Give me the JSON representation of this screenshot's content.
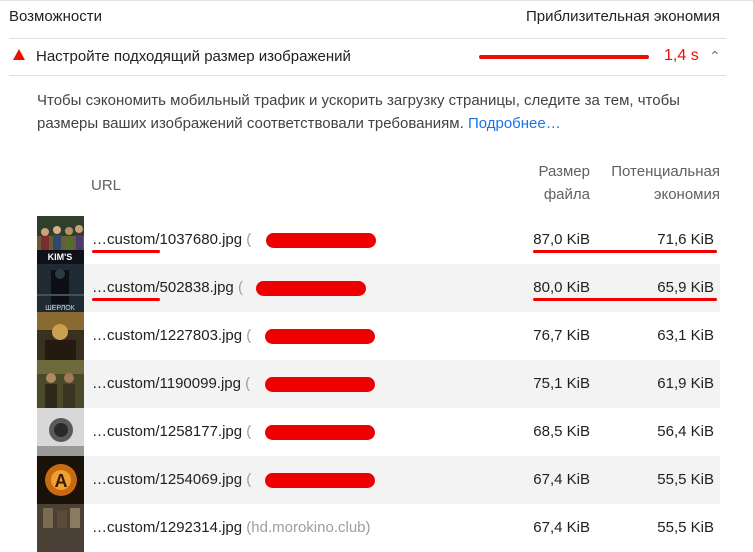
{
  "section": {
    "title": "Возможности",
    "column": "Приблизительная экономия"
  },
  "audit": {
    "title": "Настройте подходящий размер изображений",
    "savings": "1,4 s",
    "description": "Чтобы сэкономить мобильный трафик и ускорить загрузку страницы, следите за тем, чтобы размеры ваших изображений соответствовали требованиям.",
    "learn_more": "Подробнее…"
  },
  "table": {
    "headers": {
      "url": "URL",
      "size_1": "Размер",
      "size_2": "файла",
      "savings_1": "Потенциальная",
      "savings_2": "экономия"
    },
    "rows": [
      {
        "url": "…custom/1037680.jpg",
        "paren": "(",
        "size": "87,0 KiB",
        "savings": "71,6 KiB"
      },
      {
        "url": "…custom/502838.jpg",
        "paren": "(",
        "size": "80,0 KiB",
        "savings": "65,9 KiB"
      },
      {
        "url": "…custom/1227803.jpg",
        "paren": "(",
        "size": "76,7 KiB",
        "savings": "63,1 KiB"
      },
      {
        "url": "…custom/1190099.jpg",
        "paren": "(",
        "size": "75,1 KiB",
        "savings": "61,9 KiB"
      },
      {
        "url": "…custom/1258177.jpg",
        "paren": "(",
        "size": "68,5 KiB",
        "savings": "56,4 KiB"
      },
      {
        "url": "…custom/1254069.jpg",
        "paren": "(",
        "size": "67,4 KiB",
        "savings": "55,5 KiB"
      },
      {
        "url": "…custom/1292314.jpg",
        "paren": "(hd.morokino.club)",
        "size": "67,4 KiB",
        "savings": "55,5 KiB"
      }
    ],
    "thumb_labels": {
      "row0": "KIM'S",
      "row1": "ШЕРЛОК"
    }
  },
  "colors": {
    "fail": "#eb0f00",
    "link": "#1a73e8",
    "redaction": "#ee0000",
    "alt_row": "#f3f3f3"
  }
}
